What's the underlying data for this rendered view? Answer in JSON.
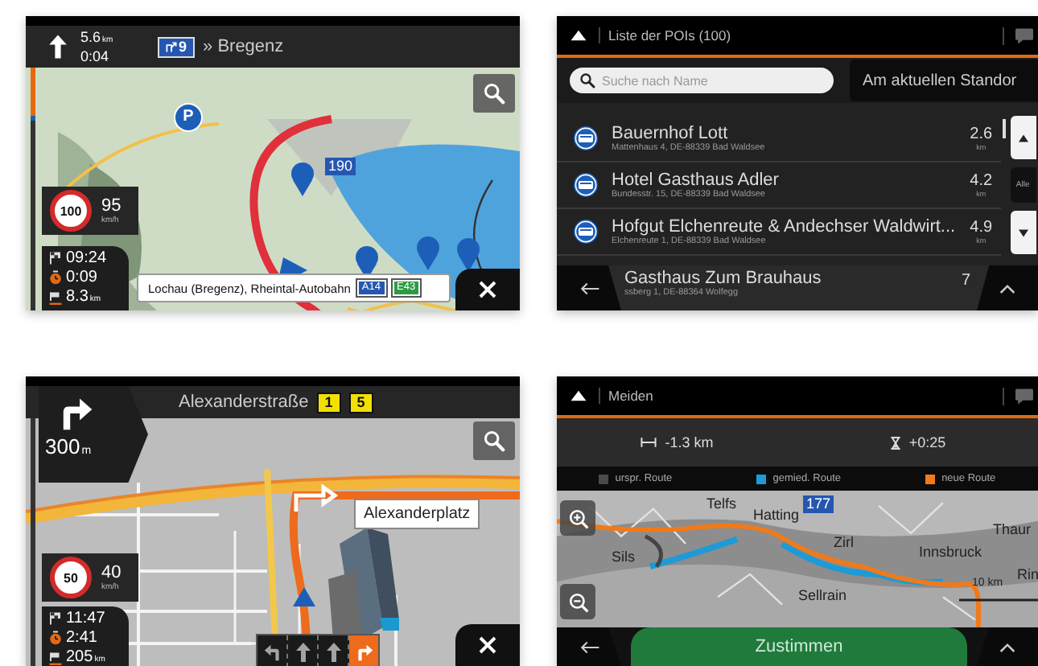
{
  "screens": [
    {
      "kind": "drive",
      "map": {
        "kind": "terrain-lake",
        "labels": [
          {
            "kind": "road",
            "text": "190"
          },
          {
            "kind": "parking",
            "text": "P"
          }
        ]
      },
      "route_progress": {
        "level": 0.3
      },
      "guidance": {
        "kind": "straight",
        "distance": "5.6",
        "distance_unit": "km",
        "time": "0:04"
      },
      "top_bar": [
        {
          "kind": "exit",
          "text": "9",
          "color": "#2557b0"
        },
        {
          "kind": "text",
          "text": "» Bregenz"
        }
      ],
      "speed": {
        "limit": "100",
        "current": "95",
        "unit": "km/h"
      },
      "trip": [
        {
          "kind": "arrival",
          "value": "09:24"
        },
        {
          "kind": "remaining",
          "value": "0:09"
        },
        {
          "kind": "distance",
          "value": "8.3",
          "unit": "km"
        }
      ],
      "street_label": {
        "text": "Lochau (Bregenz), Rheintal-Autobahn",
        "shields": [
          {
            "text": "A14",
            "color": "#2557b0"
          },
          {
            "text": "E43",
            "color": "#2f9a45"
          }
        ]
      }
    },
    {
      "kind": "list",
      "title": "Liste der POIs (100)",
      "search": {
        "placeholder": "Suche nach Name"
      },
      "filter": "Am aktuellen Standor",
      "items": [
        {
          "name": "Bauernhof Lott",
          "address": "Mattenhaus 4, DE-88339 Bad Waldsee",
          "distance": "2.6",
          "unit": "km"
        },
        {
          "name": "Hotel Gasthaus Adler",
          "address": "Bundesstr. 15, DE-88339 Bad Waldsee",
          "distance": "4.2",
          "unit": "km"
        },
        {
          "name": "Hofgut Elchenreute & Andechser Waldwirt...",
          "address": "Elchenreute 1, DE-88339 Bad Waldsee",
          "distance": "4.9",
          "unit": "km"
        }
      ],
      "partial_item": {
        "name": "Gasthaus Zum Brauhaus",
        "address": "ssberg 1, DE-88364 Wolfegg",
        "distance": "7"
      },
      "side_label": "Alle"
    },
    {
      "kind": "drive",
      "map": {
        "kind": "city-3d",
        "labels": [
          {
            "kind": "place",
            "text": "Alexanderplatz"
          }
        ]
      },
      "route_progress": {
        "level": 0.02
      },
      "guidance": {
        "kind": "right",
        "distance": "300",
        "distance_unit": "m"
      },
      "top_bar": [
        {
          "kind": "text",
          "text": "Alexanderstraße"
        },
        {
          "kind": "shield",
          "text": "1",
          "color": "#f2e000"
        },
        {
          "kind": "shield",
          "text": "5",
          "color": "#f2e000"
        }
      ],
      "speed": {
        "limit": "50",
        "current": "40",
        "unit": "km/h"
      },
      "trip": [
        {
          "kind": "arrival",
          "value": "11:47"
        },
        {
          "kind": "remaining",
          "value": "2:41"
        },
        {
          "kind": "distance",
          "value": "205",
          "unit": "km"
        }
      ],
      "lanes": [
        {
          "kind": "left",
          "selected": false
        },
        {
          "kind": "straight",
          "selected": false
        },
        {
          "kind": "straight",
          "selected": false
        },
        {
          "kind": "right",
          "selected": true
        }
      ]
    },
    {
      "kind": "detour",
      "title": "Meiden",
      "distance_change": "-1.3 km",
      "time_change": "+0:25",
      "legend": [
        {
          "label": "urspr. Route",
          "color": "#4a4a4a"
        },
        {
          "label": "gemied. Route",
          "color": "#1e9ad6"
        },
        {
          "label": "neue Route",
          "color": "#f07a1a"
        }
      ],
      "map_labels": [
        {
          "kind": "place",
          "text": "Telfs"
        },
        {
          "kind": "road",
          "text": "177"
        },
        {
          "kind": "place",
          "text": "Hatting"
        },
        {
          "kind": "place",
          "text": "Zirl"
        },
        {
          "kind": "place",
          "text": "Innsbruck"
        },
        {
          "kind": "place",
          "text": "Sils"
        },
        {
          "kind": "place",
          "text": "Sellrain"
        },
        {
          "kind": "place",
          "text": "Thaur"
        },
        {
          "kind": "place",
          "text": "Rin"
        },
        {
          "kind": "scale",
          "text": "10 km"
        }
      ],
      "button": "Zustimmen"
    }
  ]
}
